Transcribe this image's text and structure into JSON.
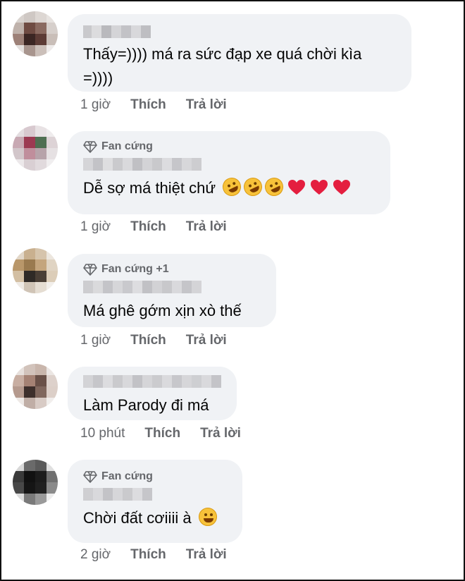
{
  "comments": [
    {
      "badge": "",
      "text_line1": "Thấy=)))) má ra sức đạp xe quá chời kìa",
      "text_line2": "=))))",
      "time": "1 giờ",
      "like": "Thích",
      "reply": "Trả lời"
    },
    {
      "badge": "Fan cứng",
      "text_line1": "Dễ sợ má thiệt chứ",
      "emojis": [
        "rolling-on-floor-laughing",
        "rolling-on-floor-laughing",
        "rolling-on-floor-laughing",
        "red-heart",
        "red-heart",
        "red-heart"
      ],
      "time": "1 giờ",
      "like": "Thích",
      "reply": "Trả lời"
    },
    {
      "badge": "Fan cứng +1",
      "text_line1": "Má ghê gớm xịn xò thế",
      "time": "1 giờ",
      "like": "Thích",
      "reply": "Trả lời"
    },
    {
      "badge": "",
      "text_line1": "Làm Parody đi má",
      "time": "10 phút",
      "like": "Thích",
      "reply": "Trả lời"
    },
    {
      "badge": "Fan cứng",
      "text_line1": "Chời đất cơiiii à",
      "emojis": [
        "face-with-tears-of-joy"
      ],
      "time": "2 giờ",
      "like": "Thích",
      "reply": "Trả lời"
    }
  ],
  "colors": {
    "bubble_bg": "#f0f2f5",
    "text": "#050505",
    "secondary": "#65676b",
    "heart": "#e41e3f",
    "emoji_yellow": "#f7c23a"
  },
  "icons": {
    "badge": "diamond-icon"
  }
}
